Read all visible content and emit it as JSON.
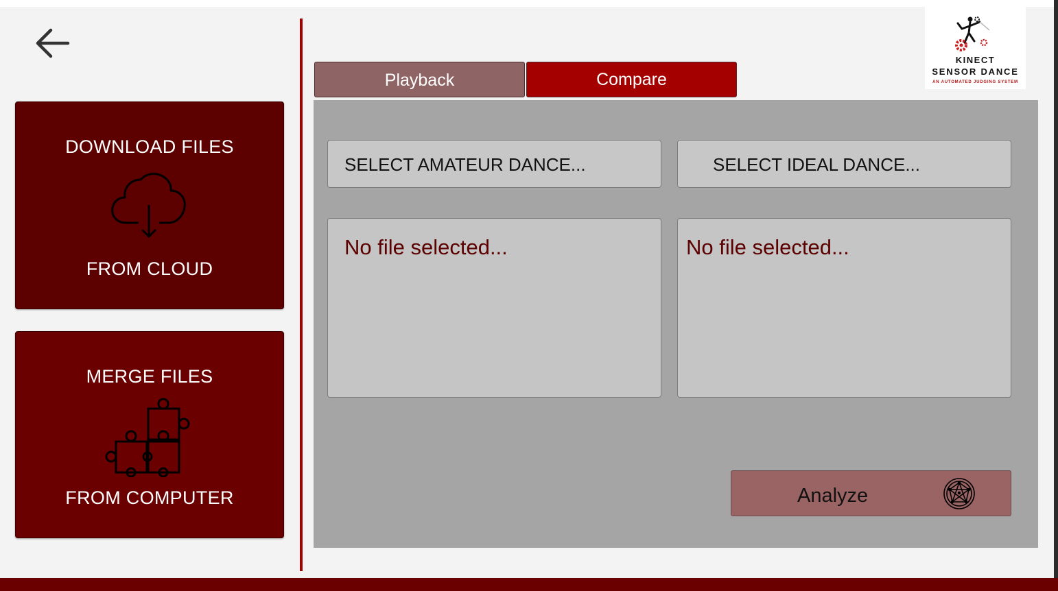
{
  "nav": {
    "back_icon": "arrow-left-icon"
  },
  "sidebar": {
    "download": {
      "title": "DOWNLOAD FILES",
      "subtitle": "FROM CLOUD",
      "icon": "cloud-download-icon",
      "color": "#5c0000"
    },
    "merge": {
      "title": "MERGE FILES",
      "subtitle": "FROM COMPUTER",
      "icon": "puzzle-icon",
      "color": "#6b0000"
    }
  },
  "tabs": [
    {
      "label": "Playback",
      "active": false,
      "color": "#8e6464"
    },
    {
      "label": "Compare",
      "active": true,
      "color": "#a50000"
    }
  ],
  "logo": {
    "line1": "KINECT",
    "line2": "SENSOR DANCE",
    "tagline": "AN AUTOMATED JUDGING SYSTEM",
    "icon": "dancer-gears-logo"
  },
  "compare": {
    "amateur": {
      "button_label": "SELECT AMATEUR DANCE...",
      "file_text": "No file selected..."
    },
    "ideal": {
      "button_label": "SELECT IDEAL DANCE...",
      "file_text": "No file selected..."
    },
    "analyze": {
      "label": "Analyze",
      "icon": "network-analysis-icon"
    }
  },
  "colors": {
    "accent": "#a50000",
    "dark_red": "#5c0000",
    "panel_gray": "#a5a5a5"
  }
}
